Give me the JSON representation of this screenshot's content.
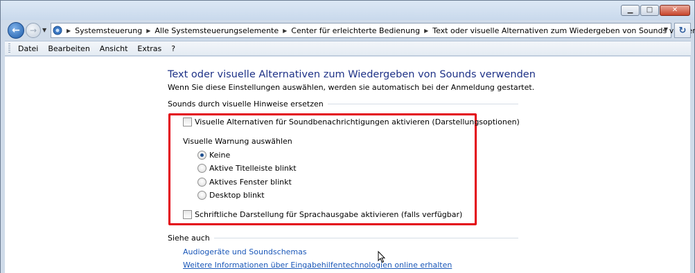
{
  "window": {
    "controls": {
      "minimize": "▁",
      "maximize": "□",
      "close": "✕"
    }
  },
  "nav": {
    "back_glyph": "←",
    "forward_glyph": "→",
    "dropdown_glyph": "▼",
    "refresh_glyph": "↻",
    "breadcrumbs": [
      "Systemsteuerung",
      "Alle Systemsteuerungselemente",
      "Center für erleichterte Bedienung",
      "Text oder visuelle Alternativen zum Wiedergeben von Sounds verwenden"
    ]
  },
  "menu": {
    "items": [
      "Datei",
      "Bearbeiten",
      "Ansicht",
      "Extras",
      "?"
    ]
  },
  "page": {
    "title": "Text oder visuelle Alternativen zum Wiedergeben von Sounds verwenden",
    "subtitle": "Wenn Sie diese Einstellungen auswählen, werden sie automatisch bei der Anmeldung gestartet."
  },
  "sound_section": {
    "heading": "Sounds durch visuelle Hinweise ersetzen",
    "visual_alt_checkbox": {
      "label": "Visuelle Alternativen für Soundbenachrichtigungen aktivieren (Darstellungsoptionen)",
      "checked": false
    },
    "warning_group_label": "Visuelle Warnung auswählen",
    "radio_options": [
      {
        "label": "Keine",
        "checked": true
      },
      {
        "label": "Aktive Titelleiste blinkt",
        "checked": false
      },
      {
        "label": "Aktives Fenster blinkt",
        "checked": false
      },
      {
        "label": "Desktop blinkt",
        "checked": false
      }
    ],
    "captions_checkbox": {
      "label": "Schriftliche Darstellung für Sprachausgabe aktivieren (falls verfügbar)",
      "checked": false
    }
  },
  "see_also": {
    "heading": "Siehe auch",
    "links": [
      "Audiogeräte und Soundschemas",
      "Weitere Informationen über Eingabehilfentechnologien online erhalten"
    ]
  },
  "colors": {
    "title_blue": "#1e3287",
    "link_blue": "#1a57b8",
    "highlight_red": "#e3000f"
  },
  "icons": [
    "back-arrow-icon",
    "forward-arrow-icon",
    "control-panel-icon",
    "refresh-icon",
    "mouse-cursor-icon"
  ]
}
